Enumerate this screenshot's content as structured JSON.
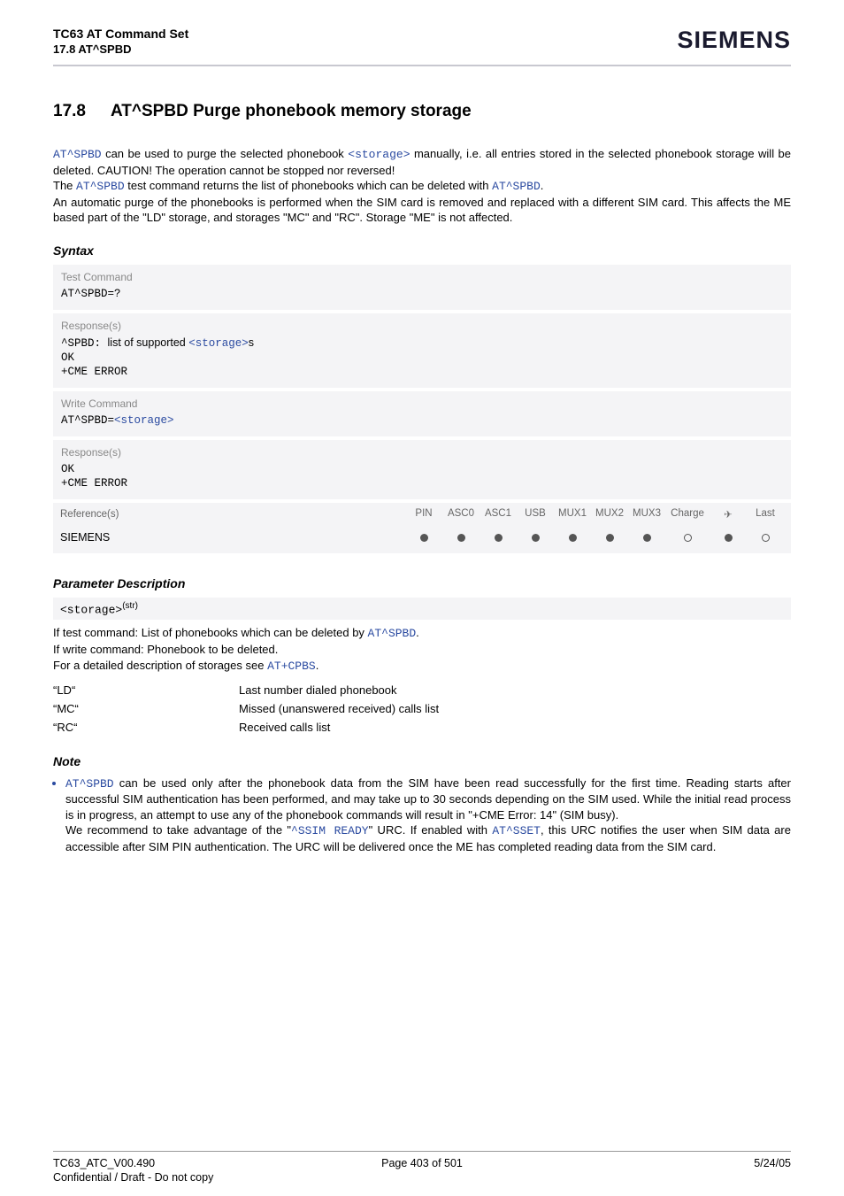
{
  "header": {
    "title": "TC63 AT Command Set",
    "subtitle": "17.8 AT^SPBD",
    "brand": "SIEMENS"
  },
  "section": {
    "number": "17.8",
    "title": "AT^SPBD   Purge phonebook memory storage"
  },
  "intro": {
    "cmd1": "AT^SPBD",
    "text1a": " can be used to purge the selected phonebook ",
    "storage": "<storage>",
    "text1b": " manually, i.e. all entries stored in the selected phonebook storage will be deleted. CAUTION! The operation cannot be stopped nor reversed!",
    "text2a": "The ",
    "text2b": " test command returns the list of phonebooks which can be deleted with ",
    "text2c": ".",
    "text3": "An automatic purge of the phonebooks is performed when the SIM card is removed and replaced with a different SIM card. This affects the ME based part of the \"LD\" storage, and storages \"MC\" and \"RC\". Storage \"ME\" is not affected."
  },
  "syntax": {
    "heading": "Syntax",
    "test_label": "Test Command",
    "test_cmd": "AT^SPBD=?",
    "responses_label": "Response(s)",
    "test_resp_prefix": "^SPBD: ",
    "test_resp_mid": "list of supported ",
    "test_resp_storage": "<storage>",
    "test_resp_suffix": "s",
    "ok": "OK",
    "cme": "+CME ERROR",
    "write_label": "Write Command",
    "write_cmd_prefix": "AT^SPBD=",
    "write_cmd_storage": "<storage>",
    "ref_label": "Reference(s)",
    "ref_headers": [
      "PIN",
      "ASC0",
      "ASC1",
      "USB",
      "MUX1",
      "MUX2",
      "MUX3",
      "Charge",
      "✈",
      "Last"
    ],
    "siemens": "SIEMENS",
    "dots": [
      "filled",
      "filled",
      "filled",
      "filled",
      "filled",
      "filled",
      "filled",
      "empty",
      "filled",
      "empty"
    ]
  },
  "param": {
    "heading": "Parameter Description",
    "name": "<storage>",
    "sup": "(str)",
    "desc1a": "If test command: List of phonebooks which can be deleted by ",
    "desc1b": ".",
    "desc2": "If write command: Phonebook to be deleted.",
    "desc3a": "For a detailed description of storages see ",
    "desc3cmd": "AT+CPBS",
    "desc3b": ".",
    "values": [
      {
        "code": "“LD“",
        "text": "Last number dialed phonebook"
      },
      {
        "code": "“MC“",
        "text": "Missed (unanswered received) calls list"
      },
      {
        "code": "“RC“",
        "text": "Received calls list"
      }
    ]
  },
  "note": {
    "heading": "Note",
    "text1a": " can be used only after the phonebook data from the SIM have been read successfully for the first time. Reading starts after successful SIM authentication has been performed, and may take up to 30 seconds depending on the SIM used. While the initial read process is in progress, an attempt to use any of the phonebook commands will result in \"+CME Error: 14\" (SIM busy).",
    "text2a": "We recommend to take advantage of the \"",
    "urc": "^SSIM READY",
    "text2b": "\" URC. If enabled with ",
    "sset": "AT^SSET",
    "text2c": ", this URC notifies the user when SIM data are accessible after SIM PIN authentication. The URC will be delivered once the ME has completed reading data from the SIM card."
  },
  "footer": {
    "left": "TC63_ATC_V00.490",
    "center": "Page 403 of 501",
    "right": "5/24/05",
    "confidential": "Confidential / Draft - Do not copy"
  }
}
